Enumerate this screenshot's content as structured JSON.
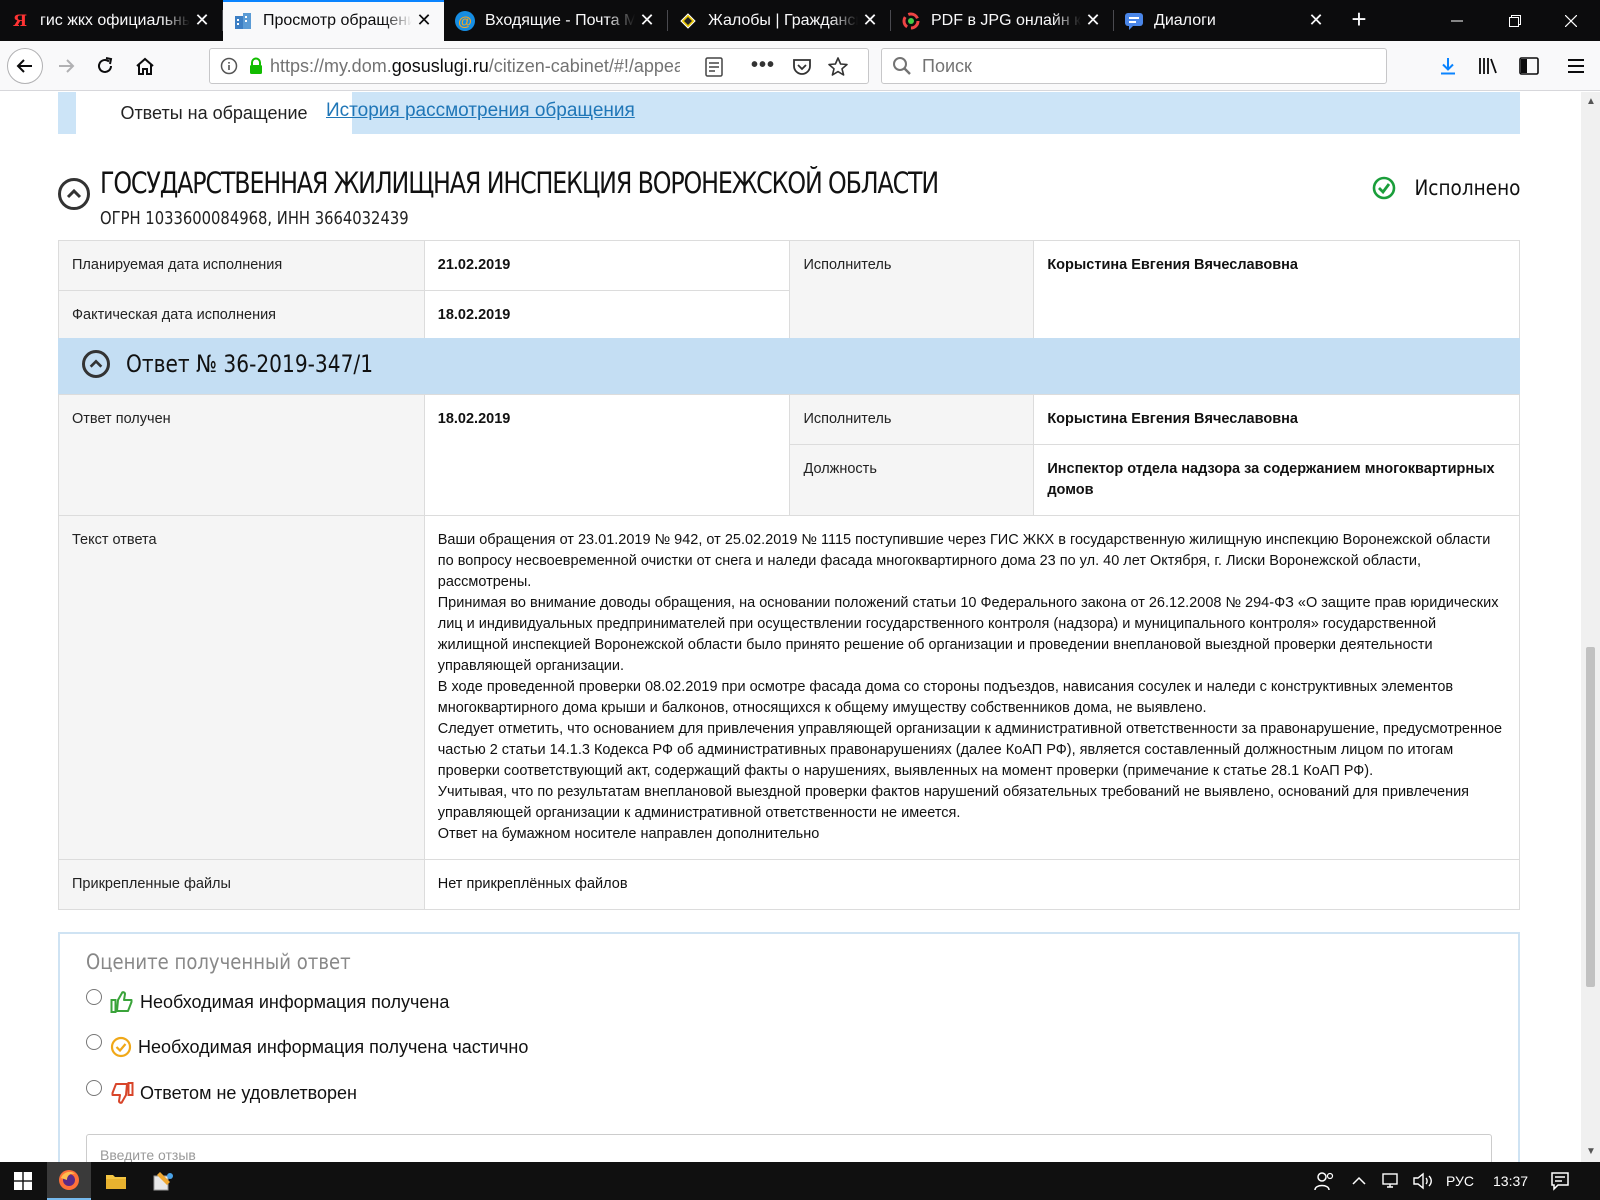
{
  "browser": {
    "tabs": [
      {
        "title": "гис жкх официальный",
        "favicon": "yandex-icon",
        "active": false
      },
      {
        "title": "Просмотр обращения",
        "favicon": "building-icon",
        "active": true
      },
      {
        "title": "Входящие - Почта Mail.ru",
        "favicon": "mail-at-icon",
        "active": false
      },
      {
        "title": "Жалобы | Гражданский",
        "favicon": "diamond-icon",
        "active": false
      },
      {
        "title": "PDF в JPG онлайн конвертер",
        "favicon": "converter-icon",
        "active": false
      },
      {
        "title": "Диалоги",
        "favicon": "chat-icon",
        "active": false
      }
    ],
    "url_prefix": "https://my.dom.",
    "url_domain": "gosuslugi.ru",
    "url_path": "/citizen-cabinet/#!/appeal",
    "search_placeholder": "Поиск"
  },
  "subtabs": {
    "active": "Ответы на обращение",
    "history": "История рассмотрения обращения"
  },
  "organization": {
    "name": "ГОСУДАРСТВЕННАЯ ЖИЛИЩНАЯ ИНСПЕКЦИЯ ВОРОНЕЖСКОЙ ОБЛАСТИ",
    "ids": "ОГРН 1033600084968, ИНН 3664032439",
    "status": "Исполнено",
    "status_color": "#1a9e3a"
  },
  "summary": {
    "planned_label": "Планируемая дата исполнения",
    "planned_value": "21.02.2019",
    "actual_label": "Фактическая дата исполнения",
    "actual_value": "18.02.2019",
    "executor_label": "Исполнитель",
    "executor_value": "Корыстина Евгения Вячеславовна"
  },
  "answer": {
    "title": "Ответ № 36-2019-347/1",
    "received_label": "Ответ получен",
    "received_value": "18.02.2019",
    "executor_label": "Исполнитель",
    "executor_value": "Корыстина Евгения Вячеславовна",
    "position_label": "Должность",
    "position_value": "Инспектор отдела надзора за содержанием многоквартирных домов",
    "text_label": "Текст ответа",
    "text_paragraphs": [
      "Ваши обращения от 23.01.2019 № 942, от 25.02.2019 № 1115 поступившие через ГИС ЖКХ в государственную жилищную инспекцию Воронежской области по вопросу несвоевременной очистки от снега и наледи фасада многоквартирного дома 23 по ул. 40 лет Октября, г. Лиски Воронежской области, рассмотрены.",
      "Принимая во внимание доводы обращения, на основании положений статьи 10 Федерального закона от 26.12.2008 № 294-ФЗ «О защите прав юридических лиц и индивидуальных предпринимателей при осуществлении государственного контроля (надзора) и муниципального контроля» государственной жилищной инспекцией Воронежской области было принято решение об организации и проведении внеплановой выездной проверки деятельности управляющей организации.",
      "В ходе проведенной проверки 08.02.2019 при осмотре  фасада дома со стороны подъездов, нависания сосулек и наледи с конструктивных элементов многоквартирного дома крыши и балконов, относящихся к общему имуществу собственников дома,  не выявлено.",
      "Следует отметить, что основанием для привлечения управляющей организации к административной ответственности за правонарушение, предусмотренное частью 2 статьи 14.1.3 Кодекса РФ об административных правонарушениях (далее КоАП РФ), является составленный должностным лицом по итогам проверки соответствующий акт, содержащий факты о нарушениях, выявленных на момент проверки (примечание к статье 28.1 КоАП РФ).",
      "Учитывая, что по результатам внеплановой выездной проверки фактов нарушений обязательных требований не выявлено, оснований для привлечения управляющей организации к административной ответственности не имеется.",
      "Ответ на бумажном носителе направлен дополнительно"
    ],
    "files_label": "Прикрепленные файлы",
    "files_value": "Нет прикреплённых файлов"
  },
  "rating": {
    "title": "Оцените полученный ответ",
    "options": [
      {
        "label": "Необходимая информация получена",
        "icon": "thumbs-up-icon",
        "color": "#3aa33a"
      },
      {
        "label": "Необходимая информация получена частично",
        "icon": "check-circle-icon",
        "color": "#f0a818"
      },
      {
        "label": "Ответом не удовлетворен",
        "icon": "thumbs-down-icon",
        "color": "#d8452a"
      }
    ],
    "feedback_placeholder": "Введите отзыв"
  },
  "taskbar": {
    "language": "РУС",
    "time": "13:37"
  },
  "colors": {
    "tab_strip": "#0c0c0d",
    "subtab_bar": "#cce4f7",
    "answer_bar": "#c4def3",
    "link": "#1f76b7"
  }
}
